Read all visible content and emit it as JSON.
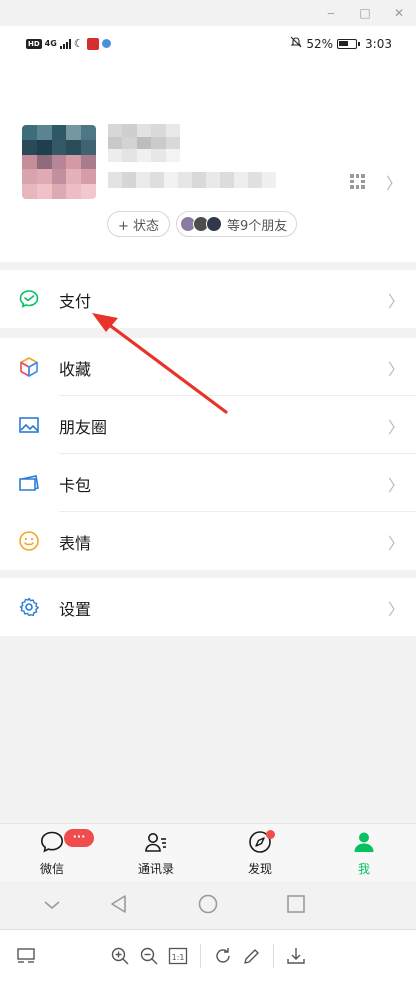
{
  "window": {
    "minimize": "‒",
    "maximize": "□",
    "close": "✕"
  },
  "status_bar": {
    "hd": "HD",
    "network": "4G",
    "battery_percent": "52%",
    "time": "3:03"
  },
  "profile": {
    "status_button": "+ 状态",
    "friends_button": "等9个朋友"
  },
  "menu": {
    "pay": "支付",
    "favorites": "收藏",
    "moments": "朋友圈",
    "cards": "卡包",
    "stickers": "表情",
    "settings": "设置"
  },
  "tabs": {
    "chats": "微信",
    "chats_badge": "···",
    "contacts": "通讯录",
    "discover": "发现",
    "me": "我"
  },
  "colors": {
    "wechat_green": "#07c160",
    "badge_red": "#f14c4c",
    "arrow_red": "#e8332a"
  },
  "icons": {
    "pay": "wechat-pay-icon",
    "favorites": "cube-icon",
    "moments": "picture-icon",
    "cards": "card-wallet-icon",
    "stickers": "smiley-icon",
    "settings": "gear-icon"
  }
}
